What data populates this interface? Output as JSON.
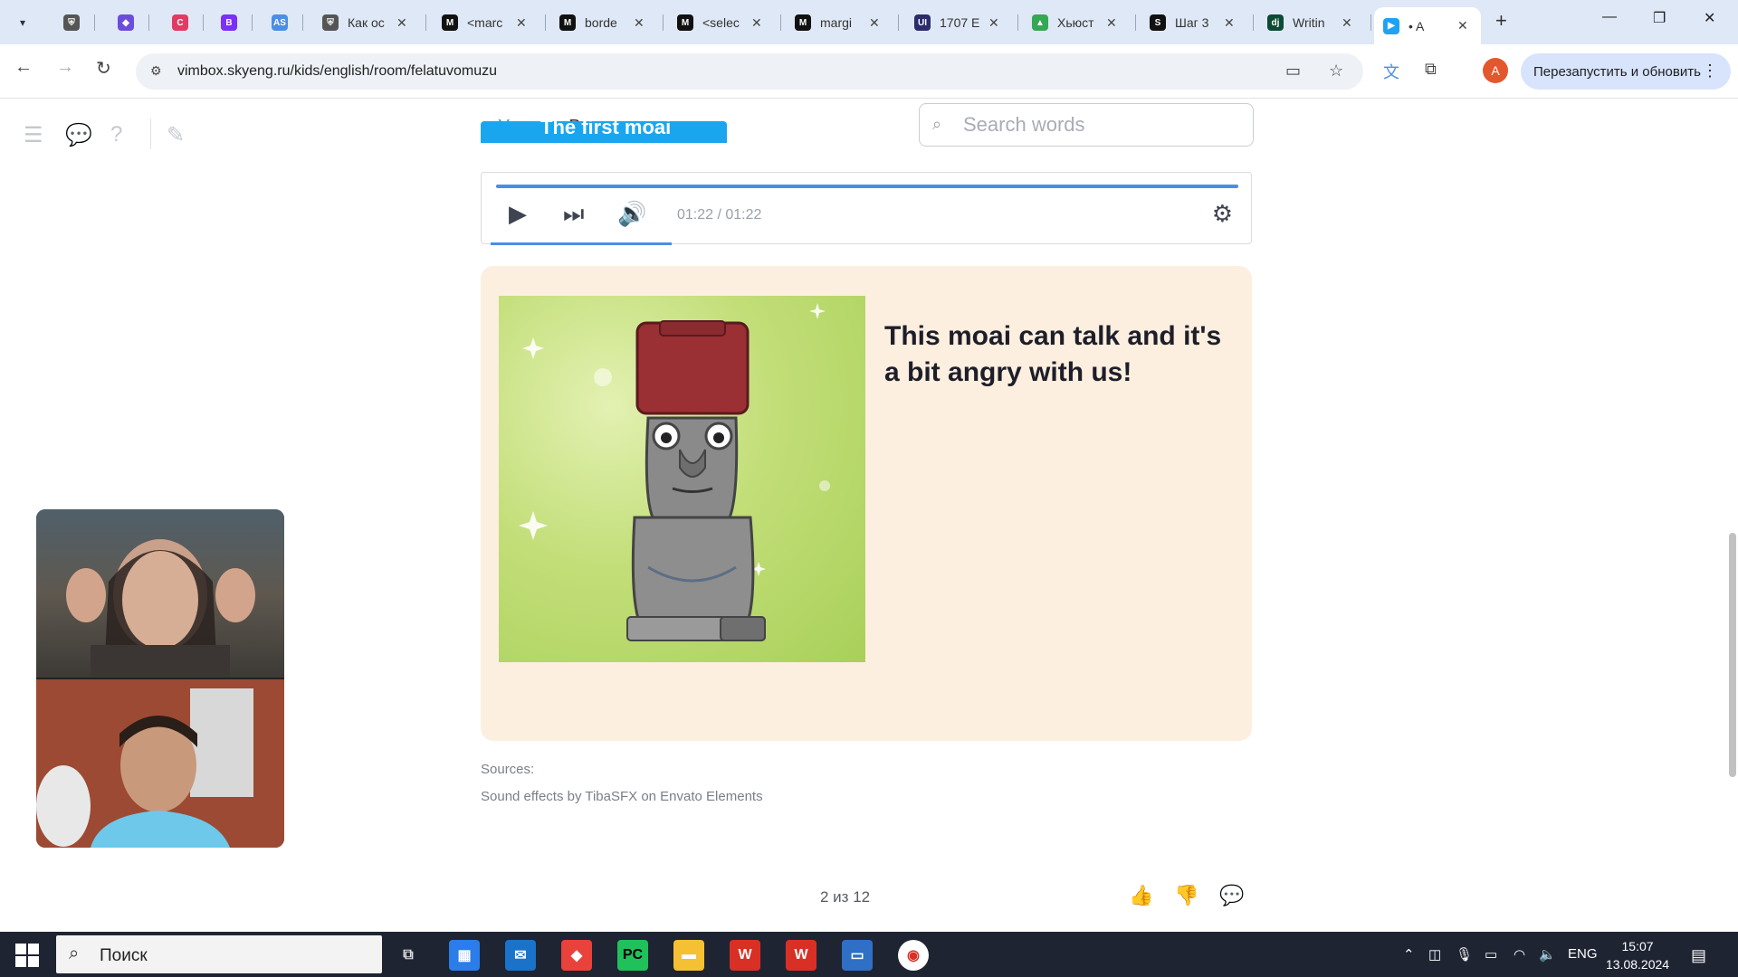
{
  "browser": {
    "tabs": [
      {
        "icon": "shield-icon",
        "label": "",
        "color": "#555"
      },
      {
        "icon": "layers-icon",
        "label": "",
        "color": "#6c4ddb"
      },
      {
        "icon": "c-icon",
        "label": "",
        "color": "#e33a64"
      },
      {
        "icon": "b-icon",
        "label": "",
        "color": "#7b2ff7"
      },
      {
        "icon": "as-icon",
        "label": "",
        "color": "#4a8fe2"
      },
      {
        "icon": "shield-icon",
        "label": "Как ос",
        "color": "#555"
      },
      {
        "icon": "m-icon",
        "label": "<marc",
        "color": "#111"
      },
      {
        "icon": "m-icon",
        "label": "borde",
        "color": "#111"
      },
      {
        "icon": "m-icon",
        "label": "<selec",
        "color": "#111"
      },
      {
        "icon": "m-icon",
        "label": "margi",
        "color": "#111"
      },
      {
        "icon": "ui-icon",
        "label": "1707 E",
        "color": "#2b2b6e"
      },
      {
        "icon": "drive-icon",
        "label": "Хьюст",
        "color": "#34a853"
      },
      {
        "icon": "s-icon",
        "label": "Шаг 3",
        "color": "#111"
      },
      {
        "icon": "dj-icon",
        "label": "Writin",
        "color": "#0c4b33"
      },
      {
        "icon": "play-icon",
        "label": "• A",
        "color": "#1fa2f3"
      }
    ],
    "url": "vimbox.skyeng.ru/kids/english/room/felatuvomuzu",
    "relaunch_label": "Перезапустить и обновить",
    "profile_initial": "A"
  },
  "lesson": {
    "tabs": [
      "Урок",
      "Вложения"
    ],
    "search_placeholder": "Search words",
    "heading": "The first moai",
    "player": {
      "time": "01:22 / 01:22",
      "progress": 1.0
    },
    "card_text": "This moai can talk and it's a bit angry with us!",
    "sources_label": "Sources:",
    "sources_text": "Sound effects by TibaSFX on Envato Elements",
    "pager": "2 из 12"
  },
  "taskbar": {
    "search_label": "Поиск",
    "lang": "ENG",
    "time": "15:07",
    "date": "13.08.2024"
  }
}
